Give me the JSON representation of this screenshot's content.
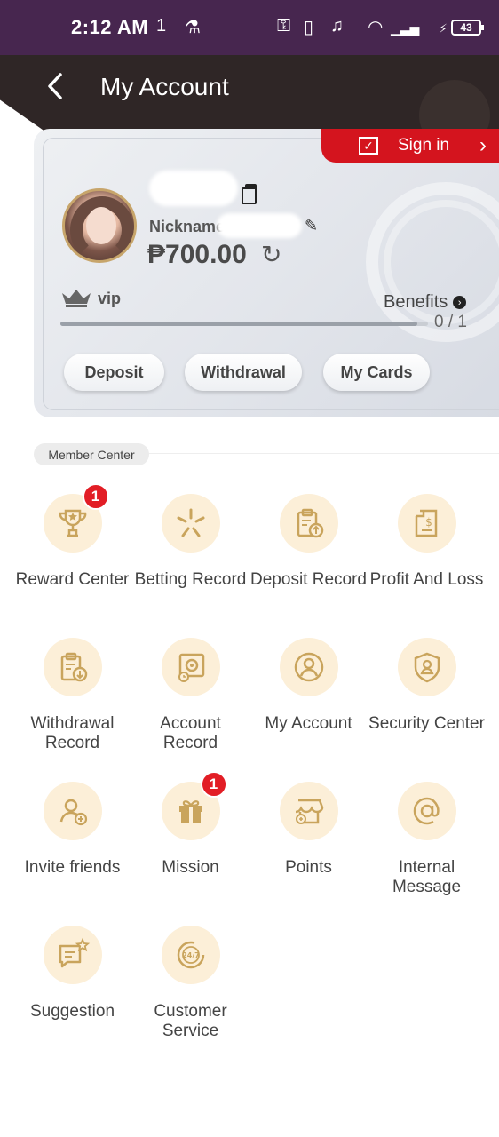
{
  "status_bar": {
    "time": "2:12 AM",
    "battery": "43"
  },
  "header": {
    "title": "My Account"
  },
  "card": {
    "sign_in_label": "Sign in",
    "nickname_label": "Nickname",
    "balance": "₱700.00",
    "vip_label": "vip",
    "benefits_label": "Benefits",
    "progress_text": "0 / 1",
    "progress_fraction": 0.97,
    "buttons": {
      "deposit": "Deposit",
      "withdrawal": "Withdrawal",
      "my_cards": "My Cards"
    }
  },
  "member_center": {
    "tag": "Member Center",
    "items": [
      {
        "label": "Reward Center",
        "icon": "trophy-icon",
        "badge": "1"
      },
      {
        "label": "Betting Record",
        "icon": "sparkle-icon"
      },
      {
        "label": "Deposit Record",
        "icon": "clipboard-upload-icon"
      },
      {
        "label": "Profit And Loss",
        "icon": "receipt-icon"
      },
      {
        "label": "Withdrawal Record",
        "icon": "clipboard-download-icon"
      },
      {
        "label": "Account Record",
        "icon": "safe-icon"
      },
      {
        "label": "My Account",
        "icon": "user-circle-icon"
      },
      {
        "label": "Security Center",
        "icon": "shield-user-icon"
      },
      {
        "label": "Invite friends",
        "icon": "add-user-icon"
      },
      {
        "label": "Mission",
        "icon": "gift-icon",
        "badge": "1"
      },
      {
        "label": "Points",
        "icon": "store-icon"
      },
      {
        "label": "Internal Message",
        "icon": "at-icon"
      },
      {
        "label": "Suggestion",
        "icon": "chat-icon"
      },
      {
        "label": "Customer Service",
        "icon": "support-24-7-icon"
      }
    ]
  },
  "colors": {
    "status_bar": "#47264f",
    "header": "#2f2626",
    "sign_in": "#d4141e",
    "icon_circle": "#fcefd8",
    "icon_stroke": "#c9a45c",
    "badge": "#e21d25"
  }
}
